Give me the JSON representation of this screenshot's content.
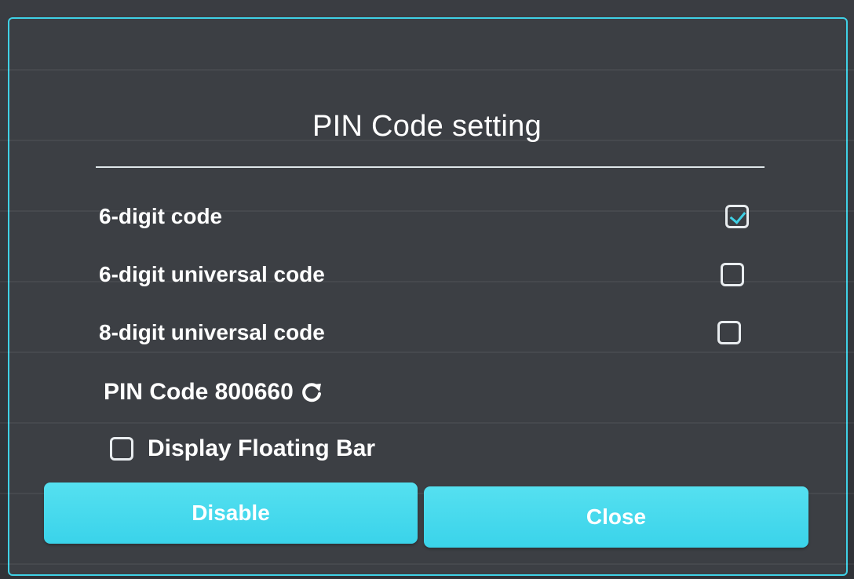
{
  "dialog": {
    "title": "PIN Code setting",
    "options": [
      {
        "label": "6-digit code",
        "checked": true
      },
      {
        "label": "6-digit universal code",
        "checked": false
      },
      {
        "label": "8-digit universal code",
        "checked": false
      }
    ],
    "pin_code_text": "PIN Code 800660",
    "floating_bar": {
      "label": "Display Floating Bar",
      "checked": false
    },
    "buttons": {
      "disable_label": "Disable",
      "close_label": "Close"
    }
  },
  "colors": {
    "accent": "#3fd1e6",
    "button": "#45d8ec",
    "dialog_background": "#3c3f44",
    "text": "#ffffff"
  },
  "icons": {
    "refresh": "refresh-icon",
    "check": "check-icon"
  }
}
